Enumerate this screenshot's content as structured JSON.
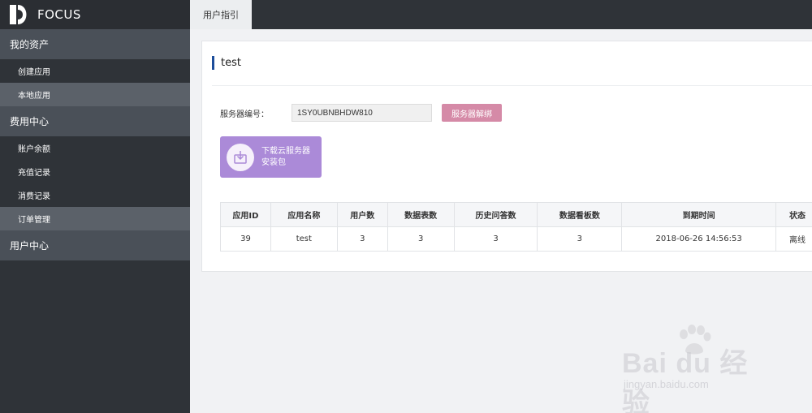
{
  "brand": {
    "name": "FOCUS"
  },
  "sidebar": {
    "groups": [
      {
        "label": "我的资产",
        "items": [
          {
            "label": "创建应用"
          },
          {
            "label": "本地应用"
          }
        ]
      },
      {
        "label": "费用中心",
        "items": [
          {
            "label": "账户余额"
          },
          {
            "label": "充值记录"
          },
          {
            "label": "消费记录"
          },
          {
            "label": "订单管理"
          }
        ]
      },
      {
        "label": "用户中心"
      }
    ]
  },
  "topbar": {
    "tab_label": "用户指引"
  },
  "panel": {
    "title": "test",
    "server_label": "服务器编号：",
    "server_value": "1SY0UBNBHDW810",
    "unbind_label": "服务器解绑",
    "download_line1": "下载云服务器",
    "download_line2": "安装包"
  },
  "table": {
    "headers": [
      "应用ID",
      "应用名称",
      "用户数",
      "数据表数",
      "历史问答数",
      "数据看板数",
      "到期时间",
      "状态"
    ],
    "rows": [
      [
        "39",
        "test",
        "3",
        "3",
        "3",
        "3",
        "2018-06-26 14:56:53",
        "离线"
      ]
    ]
  },
  "watermark": {
    "main": "Bai du 经验",
    "url": "jingyan.baidu.com"
  },
  "colors": {
    "sidebar": "#2f3338",
    "accent": "#1d4e9b",
    "unbind": "#d58aa7",
    "download": "#ab8ad8"
  }
}
